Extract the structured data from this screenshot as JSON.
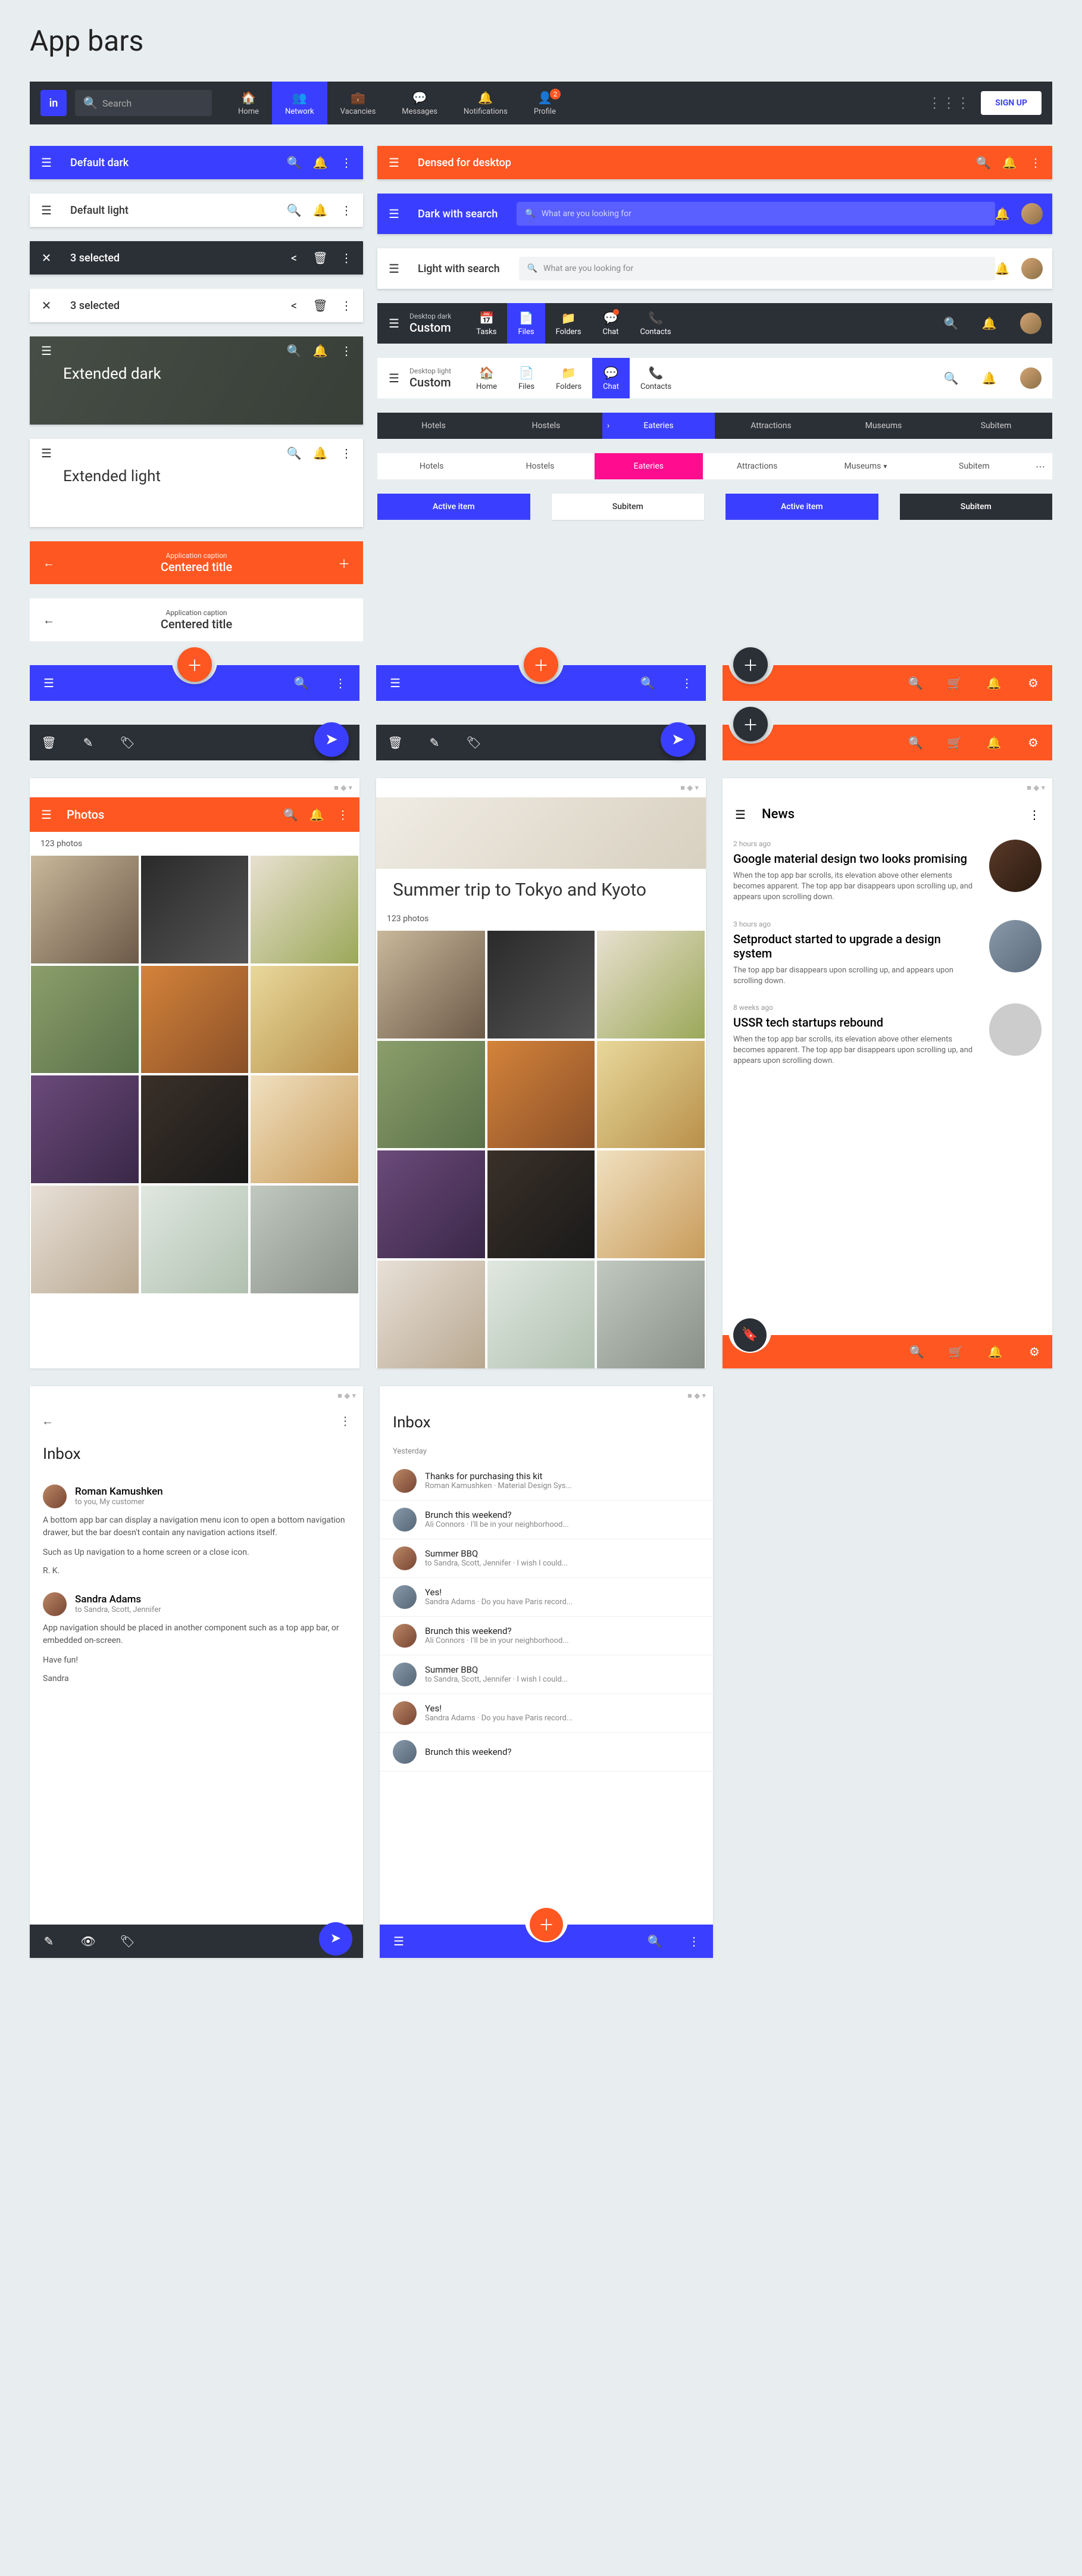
{
  "page_title": "App bars",
  "topnav": {
    "logo": "in",
    "search_placeholder": "Search",
    "tabs": [
      "Home",
      "Network",
      "Vacancies",
      "Messages",
      "Notifications",
      "Profile"
    ],
    "badge": "2",
    "signup": "SIGN UP"
  },
  "bars": {
    "default_dark": "Default dark",
    "default_light": "Default light",
    "selected": "3 selected",
    "extended_dark": "Extended dark",
    "extended_light": "Extended light",
    "app_caption": "Application caption",
    "centered_title": "Centered title",
    "densed": "Densed for desktop",
    "dark_search": "Dark with search",
    "light_search": "Light with search",
    "search_ph": "What are you looking for",
    "desktop_dark": "Desktop dark",
    "desktop_light": "Desktop light",
    "custom": "Custom",
    "tabs1": [
      "Tasks",
      "Files",
      "Folders",
      "Chat",
      "Contacts"
    ],
    "tabs2": [
      "Home",
      "Files",
      "Folders",
      "Chat",
      "Contacts"
    ],
    "pills": [
      "Hotels",
      "Hostels",
      "Eateries",
      "Attractions",
      "Museums",
      "Subitem"
    ],
    "chips": [
      "Active item",
      "Subitem",
      "Active item",
      "Subitem"
    ]
  },
  "photos": {
    "title": "Photos",
    "count": "123 photos",
    "trip": "Summer trip to Tokyo and Kyoto"
  },
  "news": {
    "title": "News",
    "items": [
      {
        "time": "2 hours ago",
        "h": "Google material design two looks promising",
        "b": "When the top app bar scrolls, its elevation above other elements becomes apparent. The top app bar disappears upon scrolling up, and appears upon scrolling down."
      },
      {
        "time": "3 hours ago",
        "h": "Setproduct started to upgrade a design system",
        "b": "The top app bar disappears upon scrolling up, and appears upon scrolling down."
      },
      {
        "time": "8 weeks ago",
        "h": "USSR tech startups rebound",
        "b": "When the top app bar scrolls, its elevation above other elements becomes apparent. The top app bar disappears upon scrolling up, and appears upon scrolling down."
      }
    ]
  },
  "inbox": {
    "title": "Inbox",
    "yesterday": "Yesterday",
    "m1": {
      "name": "Roman Kamushken",
      "to": "to you, My customer",
      "body1": "A bottom app bar can display a navigation menu icon to open a bottom navigation drawer, but the bar doesn't contain any navigation actions itself.",
      "body2": "Such as Up navigation to a home screen or a close icon.",
      "sig": "R. K."
    },
    "m2": {
      "name": "Sandra Adams",
      "to": "to Sandra, Scott, Jennifer",
      "body1": "App navigation should be placed in another component such as a top app bar, or embedded on-screen.",
      "body2": "Have fun!",
      "sig": "Sandra"
    },
    "list": [
      {
        "s": "Thanks for purchasing this kit",
        "d": "Roman Kamushken · Material Design Sys..."
      },
      {
        "s": "Brunch this weekend?",
        "d": "Ali Connors · I'll be in your neighborhood..."
      },
      {
        "s": "Summer BBQ",
        "d": "to Sandra, Scott, Jennifer · I wish I could..."
      },
      {
        "s": "Yes!",
        "d": "Sandra Adams · Do you have Paris record..."
      },
      {
        "s": "Brunch this weekend?",
        "d": "Ali Connors · I'll be in your neighborhood..."
      },
      {
        "s": "Summer BBQ",
        "d": "to Sandra, Scott, Jennifer · I wish I could..."
      },
      {
        "s": "Yes!",
        "d": "Sandra Adams · Do you have Paris record..."
      },
      {
        "s": "Brunch this weekend?",
        "d": ""
      }
    ]
  }
}
